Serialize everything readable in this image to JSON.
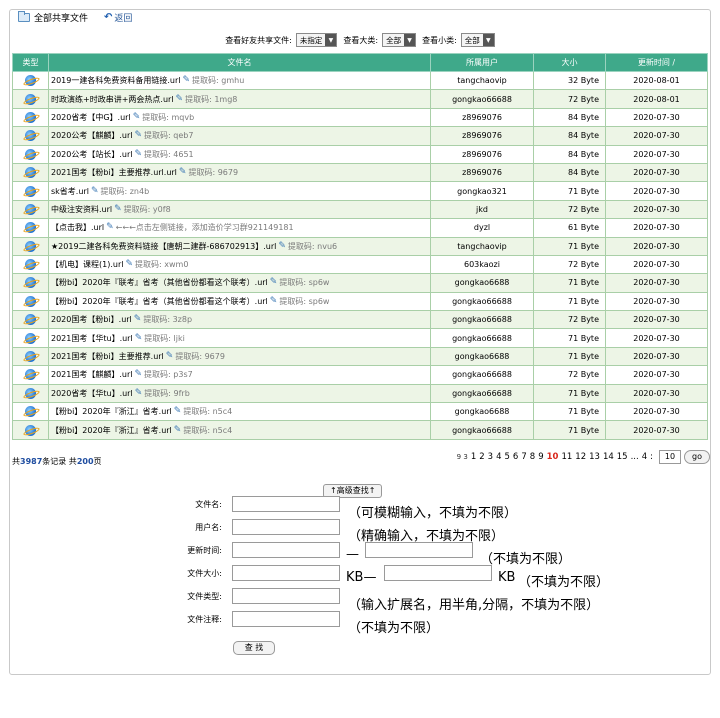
{
  "header": {
    "title": "全部共享文件",
    "back_label": "返回"
  },
  "filters": {
    "friend_label": "查看好友共享文件:",
    "friend_value": "未指定",
    "major_label": "查看大类:",
    "major_value": "全部",
    "minor_label": "查看小类:",
    "minor_value": "全部"
  },
  "table": {
    "columns": [
      "类型",
      "文件名",
      "所属用户",
      "大小",
      "更新时间 /"
    ],
    "code_label": "提取码:",
    "rows": [
      {
        "name": "2019一建各科免费资料备用链接.url",
        "code": "gmhu",
        "user": "tangchaovip",
        "size": "32 Byte",
        "time": "2020-08-01"
      },
      {
        "name": "时政演练+时政串讲+两会热点.url",
        "code": "1mg8",
        "user": "gongkao66688",
        "size": "72 Byte",
        "time": "2020-08-01"
      },
      {
        "name": "2020省考【中G】.url",
        "code": "mqvb",
        "user": "z8969076",
        "size": "84 Byte",
        "time": "2020-07-30"
      },
      {
        "name": "2020公考【麒麟】.url",
        "code": "qeb7",
        "user": "z8969076",
        "size": "84 Byte",
        "time": "2020-07-30"
      },
      {
        "name": "2020公考【站长】.url",
        "code": "4651",
        "user": "z8969076",
        "size": "84 Byte",
        "time": "2020-07-30"
      },
      {
        "name": "2021国考【粉bi】主要推荐.url.url",
        "code": "9679",
        "user": "z8969076",
        "size": "84 Byte",
        "time": "2020-07-30"
      },
      {
        "name": "sk省考.url",
        "code": "zn4b",
        "user": "gongkao321",
        "size": "71 Byte",
        "time": "2020-07-30"
      },
      {
        "name": "中级注安资料.url",
        "code": "y0f8",
        "user": "jkd",
        "size": "72 Byte",
        "time": "2020-07-30"
      },
      {
        "name": "【点击我】.url",
        "code": "←←←点击左侧链接，添加造价学习群921149181",
        "user": "dyzl",
        "size": "61 Byte",
        "time": "2020-07-30",
        "plain": true
      },
      {
        "name": "★2019二建各科免费资料链接【唐朝二建群-686702913】.url",
        "code": "nvu6",
        "user": "tangchaovip",
        "size": "71 Byte",
        "time": "2020-07-30"
      },
      {
        "name": "【机电】课程(1).url",
        "code": "xwm0",
        "user": "603kaozi",
        "size": "72 Byte",
        "time": "2020-07-30"
      },
      {
        "name": "【粉bi】2020年『联考』省考（其他省份都看这个联考）.url",
        "code": "sp6w",
        "user": "gongkao6688",
        "size": "71 Byte",
        "time": "2020-07-30"
      },
      {
        "name": "【粉bi】2020年『联考』省考（其他省份都看这个联考）.url",
        "code": "sp6w",
        "user": "gongkao66688",
        "size": "71 Byte",
        "time": "2020-07-30"
      },
      {
        "name": "2020国考【粉bi】.url",
        "code": "3z8p",
        "user": "gongkao66688",
        "size": "72 Byte",
        "time": "2020-07-30"
      },
      {
        "name": "2021国考【华tu】.url",
        "code": "ljki",
        "user": "gongkao66688",
        "size": "71 Byte",
        "time": "2020-07-30"
      },
      {
        "name": "2021国考【粉bi】主要推荐.url",
        "code": "9679",
        "user": "gongkao6688",
        "size": "71 Byte",
        "time": "2020-07-30"
      },
      {
        "name": "2021国考【麒麟】.url",
        "code": "p3s7",
        "user": "gongkao66688",
        "size": "72 Byte",
        "time": "2020-07-30"
      },
      {
        "name": "2020省考【华tu】.url",
        "code": "9frb",
        "user": "gongkao66688",
        "size": "71 Byte",
        "time": "2020-07-30"
      },
      {
        "name": "【粉bi】2020年『浙江』省考.url",
        "code": "n5c4",
        "user": "gongkao6688",
        "size": "71 Byte",
        "time": "2020-07-30"
      },
      {
        "name": "【粉bi】2020年『浙江』省考.url",
        "code": "n5c4",
        "user": "gongkao66688",
        "size": "71 Byte",
        "time": "2020-07-30"
      }
    ]
  },
  "summary": {
    "prefix": "共",
    "records": "3987",
    "mid": "条记录 共",
    "pages": "200",
    "suffix": "页"
  },
  "pager": {
    "lead": [
      "9",
      "3",
      "1"
    ],
    "pages": [
      "2",
      "3",
      "4",
      "5",
      "6",
      "7",
      "8",
      "9"
    ],
    "current": "10",
    "after": [
      "11",
      "12",
      "13",
      "14",
      "15"
    ],
    "ellipsis": "...",
    "tail": "4",
    "tail_sep": ":",
    "input_value": "10",
    "go_label": "go"
  },
  "search": {
    "advanced_label": "↑高级查找↑",
    "filename_label": "文件名:",
    "filename_note": "（可模糊输入，不填为不限）",
    "username_label": "用户名:",
    "username_note": "（精确输入，不填为不限）",
    "time_label": "更新时间:",
    "time_sep": "—",
    "time_note": "（不填为不限）",
    "size_label": "文件大小:",
    "size_unit_from": "KB—",
    "size_unit_to": "KB",
    "size_note": "（不填为不限）",
    "type_label": "文件类型:",
    "type_note": "（输入扩展名，用半角,分隔，不填为不限）",
    "comment_label": "文件注释:",
    "comment_note": "（不填为不限）",
    "submit_label": "查 找"
  }
}
